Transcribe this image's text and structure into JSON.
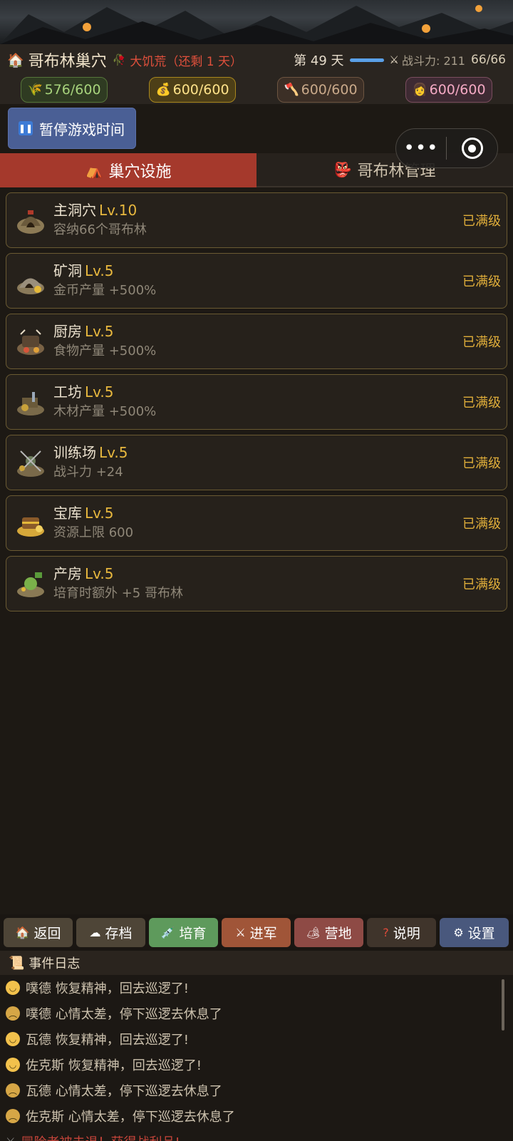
{
  "header": {
    "title": "哥布林巢穴",
    "status": "大饥荒（还剩 1 天）",
    "day": "第 49 天",
    "power": "战斗力: 211",
    "population": "66/66"
  },
  "resources": {
    "food": "576/600",
    "gold": "600/600",
    "wood": "600/600",
    "women": "600/600"
  },
  "pause_label": "暂停游戏时间",
  "tabs": {
    "facilities": "巢穴设施",
    "goblins": "哥布林管理"
  },
  "facilities": [
    {
      "name": "主洞穴",
      "level": "Lv.10",
      "effect": "容纳66个哥布林",
      "status": "已满级"
    },
    {
      "name": "矿洞",
      "level": "Lv.5",
      "effect": "金币产量 +500%",
      "status": "已满级"
    },
    {
      "name": "厨房",
      "level": "Lv.5",
      "effect": "食物产量 +500%",
      "status": "已满级"
    },
    {
      "name": "工坊",
      "level": "Lv.5",
      "effect": "木材产量 +500%",
      "status": "已满级"
    },
    {
      "name": "训练场",
      "level": "Lv.5",
      "effect": "战斗力 +24",
      "status": "已满级"
    },
    {
      "name": "宝库",
      "level": "Lv.5",
      "effect": "资源上限 600",
      "status": "已满级"
    },
    {
      "name": "产房",
      "level": "Lv.5",
      "effect": "培育时额外 +5 哥布林",
      "status": "已满级"
    }
  ],
  "nav": {
    "back": "返回",
    "save": "存档",
    "breed": "培育",
    "march": "进军",
    "camp": "营地",
    "help": "说明",
    "settings": "设置"
  },
  "log": {
    "title": "事件日志",
    "entries": [
      "噗德 恢复精神，回去巡逻了!",
      "噗德 心情太差，停下巡逻去休息了",
      "瓦德 恢复精神，回去巡逻了!",
      "佐克斯 恢复精神，回去巡逻了!",
      "瓦德 心情太差，停下巡逻去休息了",
      "佐克斯 心情太差，停下巡逻去休息了",
      "冒险者被击退！获得战利品!"
    ]
  },
  "colors": {
    "accent_tab": "#a5392c",
    "level": "#e8b83e",
    "maxed": "#e0ae3a",
    "famine": "#e0503c"
  }
}
